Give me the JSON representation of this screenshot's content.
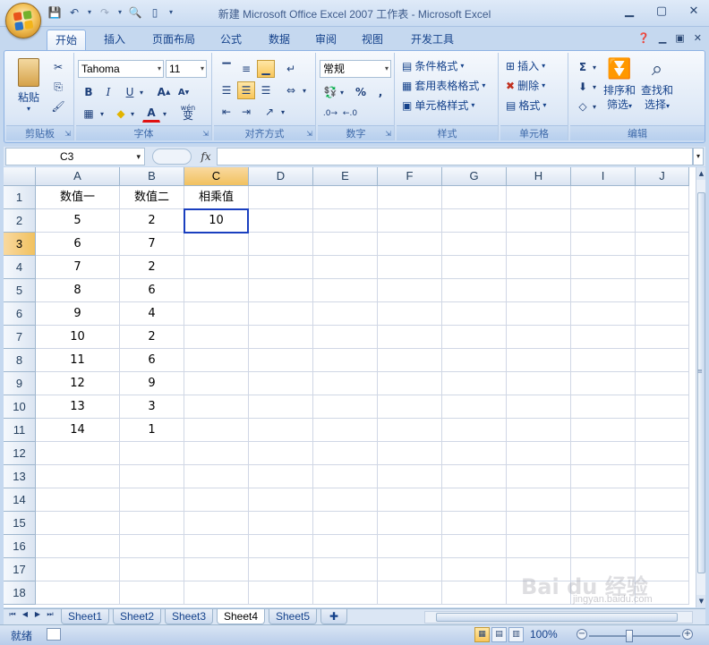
{
  "window": {
    "title": "新建 Microsoft Office Excel 2007 工作表 - Microsoft Excel"
  },
  "ribbon": {
    "tabs": [
      "开始",
      "插入",
      "页面布局",
      "公式",
      "数据",
      "审阅",
      "视图",
      "开发工具"
    ],
    "active_tab": "开始",
    "clipboard": {
      "label": "剪贴板",
      "paste": "粘贴"
    },
    "font": {
      "label": "字体",
      "name": "Tahoma",
      "size": "11",
      "wen": "wén",
      "wen2": "变"
    },
    "alignment": {
      "label": "对齐方式"
    },
    "number": {
      "label": "数字",
      "format": "常规",
      "percent": "%",
      "comma": ","
    },
    "styles": {
      "label": "样式",
      "cond": "条件格式",
      "table": "套用表格格式",
      "cell": "单元格样式"
    },
    "cells": {
      "label": "单元格",
      "insert": "插入",
      "delete": "删除",
      "format": "格式"
    },
    "editing": {
      "label": "编辑",
      "sort": "排序和",
      "sort2": "筛选",
      "find": "查找和",
      "find2": "选择",
      "sigma": "Σ"
    }
  },
  "formula_bar": {
    "name_box": "C3",
    "fx": "fx",
    "formula": ""
  },
  "sheet": {
    "columns": [
      "A",
      "B",
      "C",
      "D",
      "E",
      "F",
      "G",
      "H",
      "I",
      "J"
    ],
    "rows": [
      "1",
      "2",
      "3",
      "4",
      "5",
      "6",
      "7",
      "8",
      "9",
      "10",
      "11",
      "12",
      "13",
      "14",
      "15",
      "16",
      "17",
      "18"
    ],
    "headers": [
      "数值一",
      "数值二",
      "相乘值"
    ],
    "data": [
      [
        "5",
        "2",
        "10"
      ],
      [
        "6",
        "7",
        ""
      ],
      [
        "7",
        "2",
        ""
      ],
      [
        "8",
        "6",
        ""
      ],
      [
        "9",
        "4",
        ""
      ],
      [
        "10",
        "2",
        ""
      ],
      [
        "11",
        "6",
        ""
      ],
      [
        "12",
        "9",
        ""
      ],
      [
        "13",
        "3",
        ""
      ],
      [
        "14",
        "1",
        ""
      ]
    ]
  },
  "sheet_tabs": [
    "Sheet1",
    "Sheet2",
    "Sheet3",
    "Sheet4",
    "Sheet5"
  ],
  "active_sheet": "Sheet4",
  "status": {
    "ready": "就绪",
    "zoom": "100%"
  },
  "watermark": {
    "main": "Bai du 经验",
    "sub": "jingyan.baidu.com"
  }
}
